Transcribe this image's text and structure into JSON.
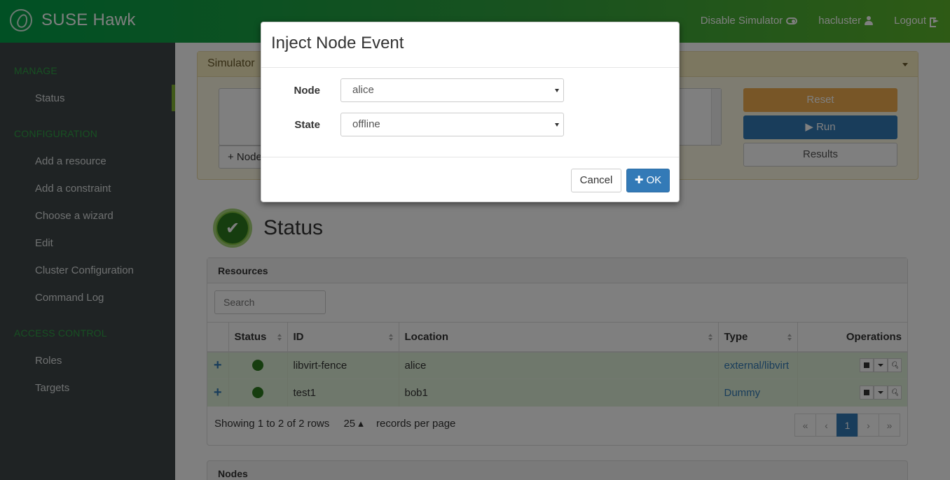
{
  "app": {
    "brand": "SUSE Hawk"
  },
  "topnav": {
    "simulator": "Disable Simulator",
    "user": "hacluster",
    "logout": "Logout"
  },
  "sidebar": {
    "manage": "MANAGE",
    "status": "Status",
    "configuration": "CONFIGURATION",
    "add_resource": "Add a resource",
    "add_constraint": "Add a constraint",
    "choose_wizard": "Choose a wizard",
    "edit": "Edit",
    "cluster_config": "Cluster Configuration",
    "command_log": "Command Log",
    "access_control": "ACCESS CONTROL",
    "roles": "Roles",
    "targets": "Targets"
  },
  "simulator": {
    "title": "Simulator",
    "node_button": "+ Node",
    "reset": "Reset",
    "run": "▶ Run",
    "results": "Results"
  },
  "status": {
    "title": "Status"
  },
  "resources": {
    "title": "Resources",
    "search_placeholder": "Search",
    "columns": {
      "status": "Status",
      "id": "ID",
      "location": "Location",
      "type": "Type",
      "operations": "Operations"
    },
    "rows": [
      {
        "expand": "+",
        "id": "libvirt-fence",
        "location": "alice",
        "type": "external/libvirt"
      },
      {
        "expand": "+",
        "id": "test1",
        "location": "bob1",
        "type": "Dummy"
      }
    ],
    "footer": {
      "showing": "Showing 1 to 2 of 2 rows",
      "page_size": "25 ▴",
      "per_page": "records per page"
    },
    "pager": {
      "first": "«",
      "prev": "‹",
      "current": "1",
      "next": "›",
      "last": "»"
    }
  },
  "nodes": {
    "title": "Nodes"
  },
  "modal": {
    "title": "Inject Node Event",
    "node_label": "Node",
    "node_value": "alice",
    "state_label": "State",
    "state_value": "offline",
    "cancel": "Cancel",
    "ok": "✚ OK"
  },
  "colors": {
    "header_green": "#02a049",
    "primary": "#337ab7",
    "warning": "#f0ad4e",
    "sidebar": "#3e4649",
    "row_success": "#dff0d8"
  }
}
